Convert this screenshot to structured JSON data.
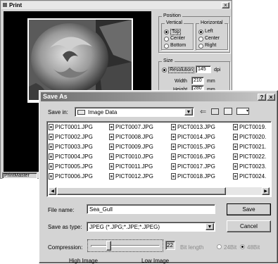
{
  "print_window": {
    "title": "Print",
    "close_glyph": "×",
    "status": "PrintMaster",
    "position": {
      "group_label": "Position",
      "vertical": {
        "label": "Vertical",
        "options": [
          "Top",
          "Center",
          "Bottom"
        ],
        "selected": "Top"
      },
      "horizontal": {
        "label": "Horizontal",
        "options": [
          "Left",
          "Center",
          "Right"
        ],
        "selected": "Left"
      }
    },
    "size": {
      "group_label": "Size",
      "resolution_label": "Resolution",
      "resolution_value": "145",
      "resolution_unit": "dpi",
      "width_label": "Width",
      "width_value": "210",
      "width_unit": "mm",
      "height_label": "Height",
      "height_value": "280",
      "height_unit": "mm"
    }
  },
  "save_as": {
    "title": "Save As",
    "help_glyph": "?",
    "close_glyph": "×",
    "save_in_label": "Save in:",
    "save_in_value": "Image Data",
    "files": [
      [
        "PICT0001.JPG",
        "PICT0002.JPG",
        "PICT0003.JPG",
        "PICT0004.JPG",
        "PICT0005.JPG",
        "PICT0006.JPG"
      ],
      [
        "PICT0007.JPG",
        "PICT0008.JPG",
        "PICT0009.JPG",
        "PICT0010.JPG",
        "PICT0011.JPG",
        "PICT0012.JPG"
      ],
      [
        "PICT0013.JPG",
        "PICT0014.JPG",
        "PICT0015.JPG",
        "PICT0016.JPG",
        "PICT0017.JPG",
        "PICT0018.JPG"
      ],
      [
        "PICT0019.",
        "PICT0020.",
        "PICT0021.",
        "PICT0022.",
        "PICT0023.",
        "PICT0024."
      ]
    ],
    "file_name_label": "File name:",
    "file_name_value": "Sea_Gull",
    "save_as_type_label": "Save as type:",
    "save_as_type_value": "JPEG (*.JPG;*.JPE;*.JPEG)",
    "save_button": "Save",
    "cancel_button": "Cancel",
    "compression_label": "Compression:",
    "compression_value": "22",
    "compression_level": 0.23,
    "bit_length_label": "Bit length",
    "bit24_label": "24Bit",
    "bit48_label": "48Bit",
    "high_image_label": "High Image",
    "low_image_label": "Low Image"
  }
}
